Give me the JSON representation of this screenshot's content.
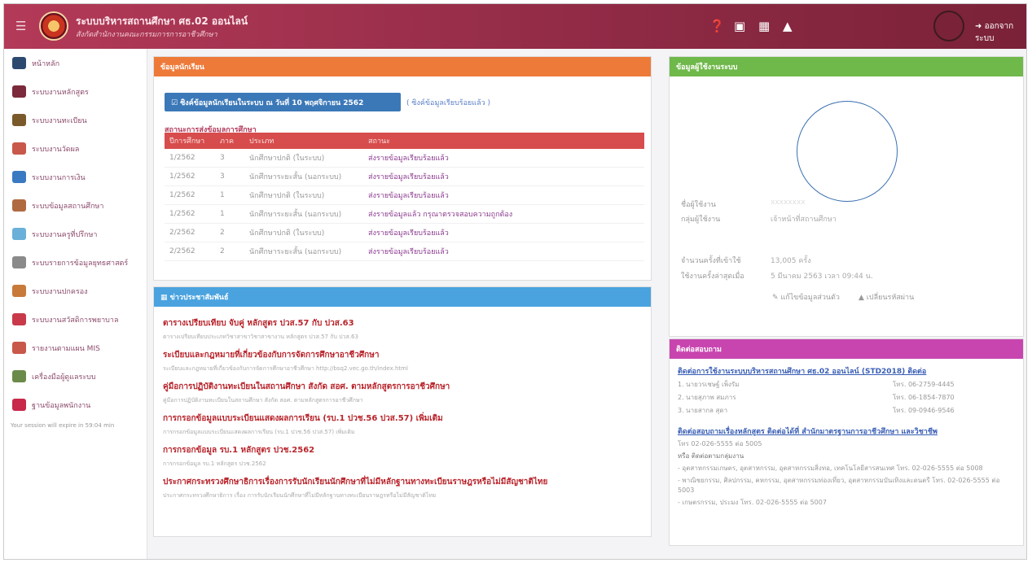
{
  "header": {
    "title": "ระบบบริหารสถานศึกษา ศธ.02 ออนไลน์",
    "subtitle": "สังกัดสำนักงานคณะกรรมการการอาชีวศึกษา",
    "logout_label": "ออกจากระบบ",
    "icons": [
      "help-icon",
      "book-icon",
      "calendar-icon",
      "bell-icon"
    ],
    "color": "#9b2f4c"
  },
  "sidebar": {
    "items": [
      {
        "label": "หน้าหลัก",
        "color": "#2b4a6e"
      },
      {
        "label": "ระบบงานหลักสูตร",
        "color": "#7a2a3a"
      },
      {
        "label": "ระบบงานทะเบียน",
        "color": "#7a5a2a"
      },
      {
        "label": "ระบบงานวัดผล",
        "color": "#c8584a"
      },
      {
        "label": "ระบบงานการเงิน",
        "color": "#3a7ac2"
      },
      {
        "label": "ระบบข้อมูลสถานศึกษา",
        "color": "#b06a40"
      },
      {
        "label": "ระบบงานครูที่ปรึกษา",
        "color": "#6ab0d8"
      },
      {
        "label": "ระบบรายการข้อมูลยุทธศาสตร์",
        "color": "#8a8a8a"
      },
      {
        "label": "ระบบงานปกครอง",
        "color": "#c87a3a"
      },
      {
        "label": "ระบบงานสวัสดิการพยาบาล",
        "color": "#c83a4a"
      },
      {
        "label": "รายงานตามแผน MIS",
        "color": "#c8584a"
      },
      {
        "label": "เครื่องมือผู้ดูแลระบบ",
        "color": "#6a8a4a"
      },
      {
        "label": "ฐานข้อมูลพนักงาน",
        "color": "#c8284a"
      }
    ],
    "session_text": "Your session will expire in 59:04 min"
  },
  "status_panel": {
    "title": "ข้อมูลนักเรียน",
    "sync_button": "ซิงค์ข้อมูลนักเรียนในระบบ ณ วันที่ 10 พฤศจิกายน 2562",
    "sync_link": "( ซิงค์ข้อมูลเรียบร้อยแล้ว )",
    "table_title": "สถานะการส่งข้อมูลการศึกษา",
    "columns": [
      "ปีการศึกษา",
      "ภาค",
      "ประเภท",
      "สถานะ"
    ],
    "rows": [
      {
        "year": "1/2562",
        "term": "3",
        "type": "นักศึกษาปกติ (ในระบบ)",
        "status": "ส่งรายข้อมูลเรียบร้อยแล้ว"
      },
      {
        "year": "1/2562",
        "term": "3",
        "type": "นักศึกษาระยะสั้น (นอกระบบ)",
        "status": "ส่งรายข้อมูลเรียบร้อยแล้ว"
      },
      {
        "year": "1/2562",
        "term": "1",
        "type": "นักศึกษาปกติ (ในระบบ)",
        "status": "ส่งรายข้อมูลเรียบร้อยแล้ว"
      },
      {
        "year": "1/2562",
        "term": "1",
        "type": "นักศึกษาระยะสั้น (นอกระบบ)",
        "status": "ส่งรายข้อมูลแล้ว กรุณาตรวจสอบความถูกต้อง"
      },
      {
        "year": "2/2562",
        "term": "2",
        "type": "นักศึกษาปกติ (ในระบบ)",
        "status": "ส่งรายข้อมูลเรียบร้อยแล้ว"
      },
      {
        "year": "2/2562",
        "term": "2",
        "type": "นักศึกษาระยะสั้น (นอกระบบ)",
        "status": "ส่งรายข้อมูลเรียบร้อยแล้ว"
      }
    ]
  },
  "news_panel": {
    "title": "ข่าวประชาสัมพันธ์",
    "items": [
      {
        "title": "ตารางเปรียบเทียบ จับคู่ หลักสูตร ปวส.57 กับ ปวส.63",
        "desc": "ตารางเปรียบเทียบประเภทวิชาสาขาวิชาสาขางาน หลักสูตร ปวส.57 กับ ปวส.63"
      },
      {
        "title": "ระเบียบและกฎหมายที่เกี่ยวข้องกับการจัดการศึกษาอาชีวศึกษา",
        "desc": "ระเบียบและกฎหมายที่เกี่ยวข้องกับการจัดการศึกษาอาชีวศึกษา http://bsq2.vec.go.th/index.html"
      },
      {
        "title": "คู่มือการปฏิบัติงานทะเบียนในสถานศึกษา สังกัด สอศ. ตามหลักสูตรการอาชีวศึกษา",
        "desc": "คู่มือการปฏิบัติงานทะเบียนในสถานศึกษา สังกัด สอศ. ตามหลักสูตรการอาชีวศึกษา"
      },
      {
        "title": "การกรอกข้อมูลแบบระเบียนแสดงผลการเรียน (รบ.1 ปวช.56 ปวส.57) เพิ่มเติม",
        "desc": "การกรอกข้อมูลแบบระเบียนแสดงผลการเรียน (รบ.1 ปวช.56 ปวส.57) เพิ่มเติม"
      },
      {
        "title": "การกรอกข้อมูล รบ.1 หลักสูตร ปวช.2562",
        "desc": "การกรอกข้อมูล รบ.1 หลักสูตร ปวช.2562"
      },
      {
        "title": "ประกาศกระทรวงศึกษาธิการเรื่องการรับนักเรียนนักศึกษาที่ไม่มีหลักฐานทางทะเบียนราษฎรหรือไม่มีสัญชาติไทย",
        "desc": "ประกาศกระทรวงศึกษาธิการ เรื่อง การรับนักเรียนนักศึกษาที่ไม่มีหลักฐานทางทะเบียนราษฎรหรือไม่มีสัญชาติไทย"
      }
    ]
  },
  "profile_panel": {
    "title": "ข้อมูลผู้ใช้งานระบบ",
    "username_label": "ชื่อผู้ใช้งาน",
    "username_value": "xxxxxxxx",
    "group_label": "กลุ่มผู้ใช้งาน",
    "group_value": "เจ้าหน้าที่สถานศึกษา",
    "login_count_label": "จำนวนครั้งที่เข้าใช้",
    "login_count_value": "13,005 ครั้ง",
    "last_login_label": "ใช้งานครั้งล่าสุดเมื่อ",
    "last_login_value": "5 มีนาคม 2563 เวลา 09:44 น.",
    "edit_link": "แก้ไขข้อมูลส่วนตัว",
    "password_link": "เปลี่ยนรหัสผ่าน"
  },
  "contact_panel": {
    "title": "ติดต่อสอบถาม",
    "link1": "ติดต่อการใช้งานระบบบริหารสถานศึกษา ศธ.02 ออนไลน์ (STD2018) ติดต่อ",
    "contacts": [
      {
        "name": "1. นายวรเชษฐ์ เพ็งรัม",
        "phone": "โทร. 06-2759-4445"
      },
      {
        "name": "2. นายสุภาพ สมภาร",
        "phone": "โทร. 06-1854-7870"
      },
      {
        "name": "3. นายสากล สุดา",
        "phone": "โทร. 09-0946-9546"
      }
    ],
    "link2": "ติดต่อสอบถามเรื่องหลักสูตร ติดต่อได้ที่ สำนักมาตรฐานการอาชีวศึกษา และวิชาชีพ",
    "phone_main": "โทร 02-026-5555 ต่อ 5005",
    "or_label": "หรือ ติดต่อตามกลุ่มงาน",
    "groups": [
      "- อุตสาหกรรมเกษตร, อุตสาหกรรม, อุตสาหกรรมสิ่งทอ, เทคโนโลยีสารสนเทศ โทร. 02-026-5555 ต่อ 5008",
      "- พาณิชยกรรม, ศิลปกรรม, คหกรรม, อุตสาหกรรมท่องเที่ยว, อุตสาหกรรมบันเทิงและดนตรี โทร. 02-026-5555 ต่อ 5003",
      "- เกษตรกรรม, ประมง โทร. 02-026-5555 ต่อ 5007"
    ]
  }
}
